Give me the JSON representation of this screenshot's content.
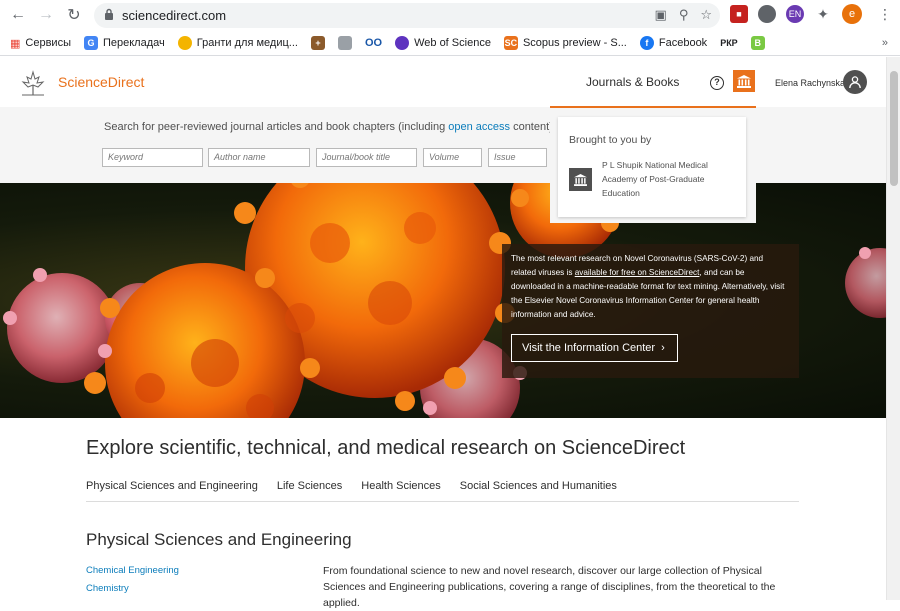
{
  "browser": {
    "url": "sciencedirect.com",
    "bookmarks": [
      {
        "label": "Сервисы",
        "icon": "apps-grid-icon",
        "color": "#4285f4"
      },
      {
        "label": "Перекладач",
        "icon": "translate-icon",
        "color": "#4285f4"
      },
      {
        "label": "Гранти для медиц...",
        "icon": "bulb-icon",
        "color": "#f4b400"
      },
      {
        "label": "",
        "icon": "cross-icon",
        "color": "#8b5a2b"
      },
      {
        "label": "",
        "icon": "document-icon",
        "color": "#7a7a7a"
      },
      {
        "label": "",
        "icon": "oo-icon",
        "color": "#1a57a8"
      },
      {
        "label": "Web of Science",
        "icon": "clarivate-icon",
        "color": "#5e33bf"
      },
      {
        "label": "Scopus preview - S...",
        "icon": "scopus-icon",
        "color": "#e9711c"
      },
      {
        "label": "Facebook",
        "icon": "facebook-icon",
        "color": "#1877f2"
      },
      {
        "label": "РКР",
        "icon": "text-icon",
        "color": "#202124"
      },
      {
        "label": "",
        "icon": "b-icon",
        "color": "#7ac943"
      }
    ],
    "profile_initial": "e",
    "ext_label": "EN"
  },
  "header": {
    "brand": "ScienceDirect",
    "journals_books": "Journals & Books",
    "help": "?",
    "user_name": "Elena Rachynska"
  },
  "search": {
    "intro_prefix": "Search for peer-reviewed journal articles and book chapters (including ",
    "intro_link": "open access",
    "intro_suffix": " content)",
    "keywords_ph": "Keyword",
    "author_ph": "Author name",
    "journal_ph": "Journal/book title",
    "volume_ph": "Volume",
    "issue_ph": "Issue"
  },
  "popover": {
    "title": "Brought to you by",
    "institution": "P L Shupik National Medical Academy of Post-Graduate Education"
  },
  "hero": {
    "text_1": "The most relevant research on Novel Coronavirus (SARS-CoV-2) and related viruses is ",
    "text_link": "available for free on ScienceDirect",
    "text_2": ", and can be downloaded in a machine-readable format for text mining. Alternatively, visit the Elsevier Novel Coronavirus Information Center for general health information and advice.",
    "button": "Visit the Information Center"
  },
  "content": {
    "explore_title": "Explore scientific, technical, and medical research on ScienceDirect",
    "tabs": [
      "Physical Sciences and Engineering",
      "Life Sciences",
      "Health Sciences",
      "Social Sciences and Humanities"
    ],
    "section_title": "Physical Sciences and Engineering",
    "sub_links": [
      "Chemical Engineering",
      "Chemistry"
    ],
    "section_desc": "From foundational science to new and novel research, discover our large collection of Physical Sciences and Engineering publications, covering a range of disciplines, from the theoretical to the applied."
  }
}
